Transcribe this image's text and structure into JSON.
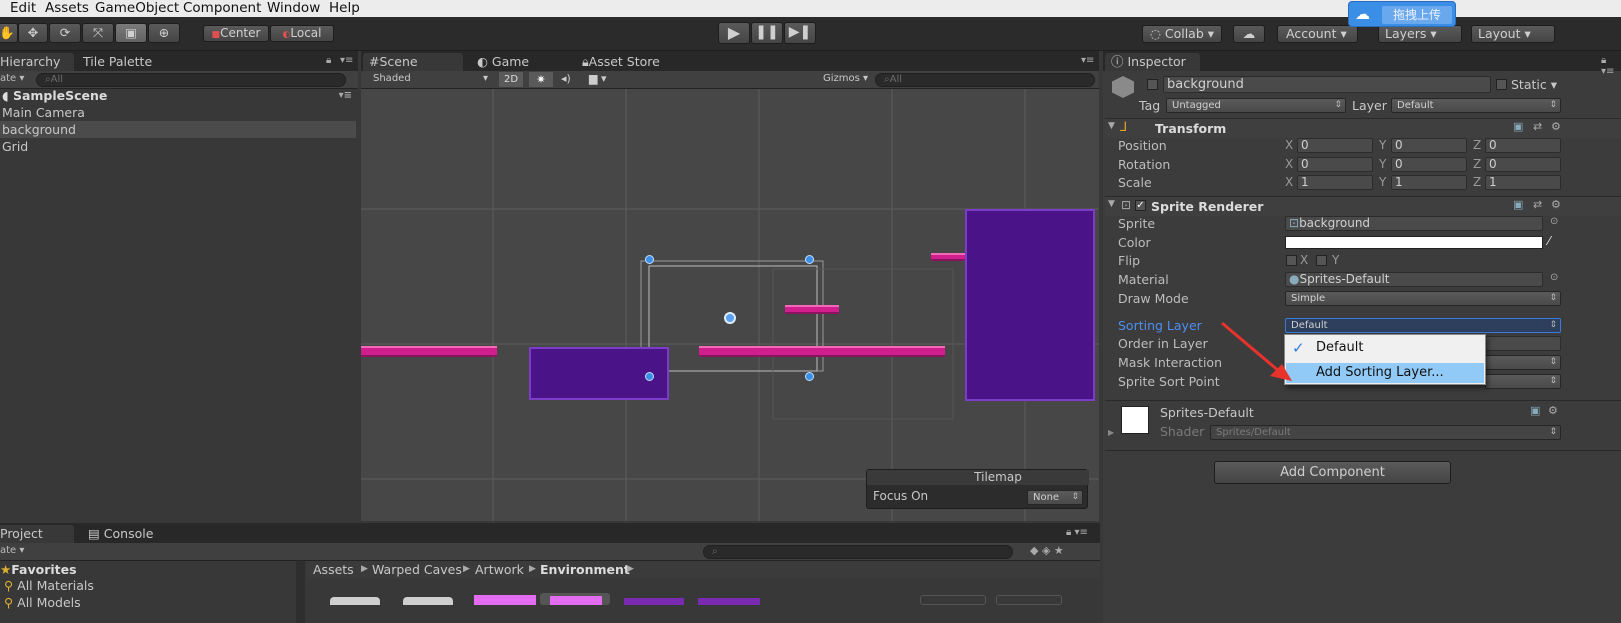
{
  "menu": [
    "Edit",
    "Assets",
    "GameObject",
    "Component",
    "Window",
    "Help"
  ],
  "toolbar": {
    "center_label": "Center",
    "local_label": "Local",
    "collab_label": "Collab",
    "account_label": "Account",
    "layers_label": "Layers",
    "layout_label": "Layout",
    "upload_badge": "拖拽上传"
  },
  "hierarchy": {
    "tab_label": "Hierarchy",
    "tab2_label": "Tile Palette",
    "create_label": "ate",
    "search_placeholder": "All",
    "scene_name": "SampleScene",
    "items": [
      "Main Camera",
      "background",
      "Grid"
    ]
  },
  "scene_view": {
    "tab_scene": "Scene",
    "tab_game": "Game",
    "tab_store": "Asset Store",
    "shading": "Shaded",
    "mode_2d": "2D",
    "gizmos": "Gizmos",
    "search_placeholder": "All"
  },
  "tilemap": {
    "title": "Tilemap",
    "focus_label": "Focus On",
    "focus_value": "None"
  },
  "project": {
    "tab_project": "Project",
    "tab_console": "Console",
    "create_label": "ate",
    "favorites_label": "Favorites",
    "fav_items": [
      "All Materials",
      "All Models"
    ],
    "breadcrumb": [
      "Assets",
      "Warped Caves",
      "Artwork",
      "Environment"
    ]
  },
  "inspector": {
    "tab_label": "Inspector",
    "object_name": "background",
    "static_label": "Static",
    "tag_label": "Tag",
    "tag_value": "Untagged",
    "layer_label": "Layer",
    "layer_value": "Default",
    "transform": {
      "title": "Transform",
      "rows": [
        {
          "label": "Position",
          "x": "0",
          "y": "0",
          "z": "0"
        },
        {
          "label": "Rotation",
          "x": "0",
          "y": "0",
          "z": "0"
        },
        {
          "label": "Scale",
          "x": "1",
          "y": "1",
          "z": "1"
        }
      ]
    },
    "sprite_renderer": {
      "title": "Sprite Renderer",
      "sprite_label": "Sprite",
      "sprite_value": "background",
      "color_label": "Color",
      "flip_label": "Flip",
      "flip_x": "X",
      "flip_y": "Y",
      "material_label": "Material",
      "material_value": "Sprites-Default",
      "draw_mode_label": "Draw Mode",
      "draw_mode_value": "Simple",
      "sorting_layer_label": "Sorting Layer",
      "sorting_layer_value": "Default",
      "order_label": "Order in Layer",
      "mask_label": "Mask Interaction",
      "sort_point_label": "Sprite Sort Point"
    },
    "material_block": {
      "name": "Sprites-Default",
      "shader_label": "Shader",
      "shader_value": "Sprites/Default"
    },
    "add_component": "Add Component",
    "dropdown": {
      "options": [
        "Default",
        "Add Sorting Layer..."
      ],
      "selected": "Default",
      "highlighted": "Add Sorting Layer..."
    }
  },
  "colors": {
    "accent_blue": "#3b8fe6",
    "platform_pink": "#d01e8c",
    "block_purple": "#4a1488",
    "arrow_red": "#e8322c"
  }
}
